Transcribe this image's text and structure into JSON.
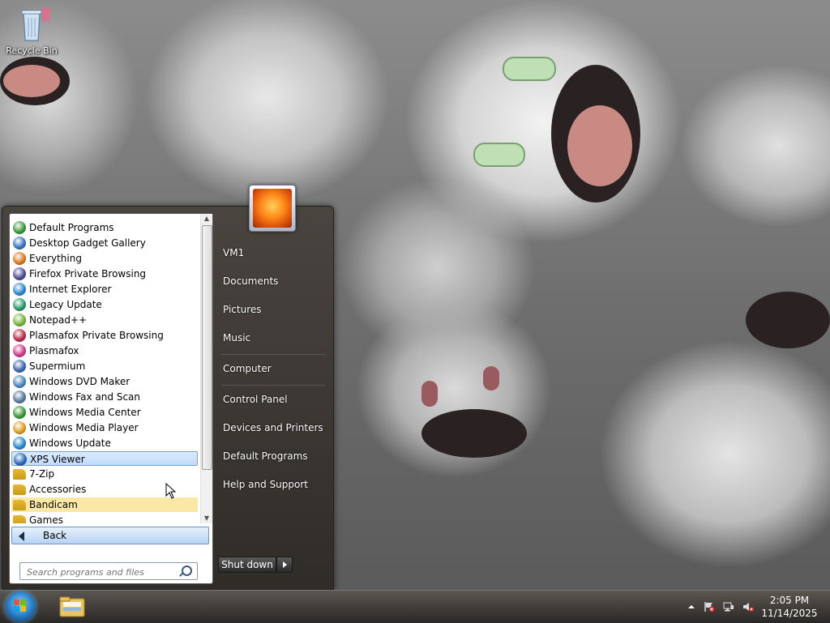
{
  "desktop": {
    "recycle_bin_label": "Recycle Bin"
  },
  "start_menu": {
    "programs": [
      {
        "label": "Default Programs",
        "icon": "default-programs-icon",
        "color": "#3a9a3a"
      },
      {
        "label": "Desktop Gadget Gallery",
        "icon": "gadget-gallery-icon",
        "color": "#3874c6"
      },
      {
        "label": "Everything",
        "icon": "everything-search-icon",
        "color": "#e07b1a"
      },
      {
        "label": "Firefox Private Browsing",
        "icon": "firefox-private-icon",
        "color": "#4d4d9a"
      },
      {
        "label": "Internet Explorer",
        "icon": "internet-explorer-icon",
        "color": "#2d8ad6"
      },
      {
        "label": "Legacy Update",
        "icon": "legacy-update-icon",
        "color": "#2d9a6a"
      },
      {
        "label": "Notepad++",
        "icon": "notepad-plus-plus-icon",
        "color": "#78b83c"
      },
      {
        "label": "Plasmafox Private Browsing",
        "icon": "plasmafox-private-icon",
        "color": "#c02a4a"
      },
      {
        "label": "Plasmafox",
        "icon": "plasmafox-icon",
        "color": "#d43a8a"
      },
      {
        "label": "Supermium",
        "icon": "supermium-icon",
        "color": "#3a6ab0"
      },
      {
        "label": "Windows DVD Maker",
        "icon": "dvd-maker-icon",
        "color": "#4a8ac0"
      },
      {
        "label": "Windows Fax and Scan",
        "icon": "fax-scan-icon",
        "color": "#5a7aa0"
      },
      {
        "label": "Windows Media Center",
        "icon": "media-center-icon",
        "color": "#3a9a3a"
      },
      {
        "label": "Windows Media Player",
        "icon": "media-player-icon",
        "color": "#e0a020"
      },
      {
        "label": "Windows Update",
        "icon": "windows-update-icon",
        "color": "#2a8ad0"
      },
      {
        "label": "XPS Viewer",
        "icon": "xps-viewer-icon",
        "color": "#2a6ac0"
      },
      {
        "label": "7-Zip",
        "icon": "folder-icon",
        "color": "#e8b830"
      },
      {
        "label": "Accessories",
        "icon": "folder-icon",
        "color": "#e8b830"
      },
      {
        "label": "Bandicam",
        "icon": "folder-icon",
        "color": "#e8b830"
      },
      {
        "label": "Games",
        "icon": "folder-icon",
        "color": "#e8b830"
      }
    ],
    "selected_index": 15,
    "hover_index": 18,
    "back_label": "Back",
    "search_placeholder": "Search programs and files",
    "right_links": {
      "user": "VM1",
      "documents": "Documents",
      "pictures": "Pictures",
      "music": "Music",
      "computer": "Computer",
      "control_panel": "Control Panel",
      "devices_printers": "Devices and Printers",
      "default_programs": "Default Programs",
      "help_support": "Help and Support"
    },
    "shutdown_label": "Shut down"
  },
  "taskbar": {
    "time": "2:05 PM",
    "date": "11/14/2025"
  },
  "colors": {
    "selection_blue": "#c1dbfc",
    "hover_yellow": "#fbe8a7"
  }
}
